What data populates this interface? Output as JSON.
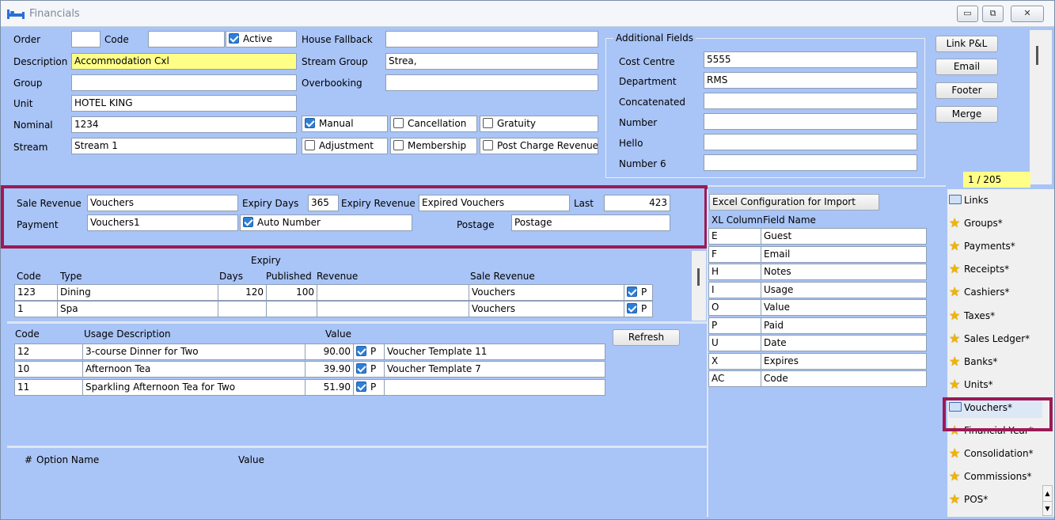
{
  "window": {
    "title": "Financials",
    "minimize": "▭",
    "restore": "⧉",
    "close": "✕"
  },
  "top": {
    "order_label": "Order",
    "order_value": "",
    "code_label": "Code",
    "code_value": "",
    "active_label": "Active",
    "description_label": "Description",
    "description_value": "Accommodation Cxl",
    "group_label": "Group",
    "group_value": "",
    "unit_label": "Unit",
    "unit_value": "HOTEL KING",
    "nominal_label": "Nominal",
    "nominal_value": "1234",
    "stream_label": "Stream",
    "stream_value": "Stream 1",
    "house_fallback_label": "House Fallback",
    "house_fallback_value": "",
    "stream_group_label": "Stream Group",
    "stream_group_value": "Strea,",
    "overbooking_label": "Overbooking",
    "overbooking_value": "",
    "manual_label": "Manual",
    "cancellation_label": "Cancellation",
    "gratuity_label": "Gratuity",
    "adjustment_label": "Adjustment",
    "membership_label": "Membership",
    "post_charge_label": "Post Charge Revenue"
  },
  "additional": {
    "title": "Additional Fields",
    "cost_centre_label": "Cost Centre",
    "cost_centre_value": "5555",
    "department_label": "Department",
    "department_value": "RMS",
    "concatenated_label": "Concatenated",
    "concatenated_value": "",
    "number_label": "Number",
    "number_value": "",
    "hello_label": "Hello",
    "hello_value": "",
    "number6_label": "Number 6",
    "number6_value": ""
  },
  "right_buttons": {
    "link_pl": "Link P&L",
    "email": "Email",
    "footer": "Footer",
    "merge": "Merge"
  },
  "record_counter": "1 / 205",
  "voucher_settings": {
    "sale_revenue_label": "Sale Revenue",
    "sale_revenue_value": "Vouchers",
    "expiry_days_label": "Expiry Days",
    "expiry_days_value": "365",
    "expiry_revenue_label": "Expiry Revenue",
    "expiry_revenue_value": "Expired Vouchers",
    "last_label": "Last",
    "last_value": "423",
    "payment_label": "Payment",
    "payment_value": "Vouchers1",
    "auto_number_label": "Auto Number",
    "postage_label": "Postage",
    "postage_value": "Postage"
  },
  "types_table": {
    "expiry_header": "Expiry",
    "headers": {
      "code": "Code",
      "type": "Type",
      "days": "Days",
      "published": "Published",
      "revenue": "Revenue",
      "sale_revenue": "Sale Revenue"
    },
    "rows": [
      {
        "code": "123",
        "type": "Dining",
        "days": "120",
        "published": "100",
        "revenue": "",
        "sale_revenue": "Vouchers",
        "p": "P"
      },
      {
        "code": "1",
        "type": "Spa",
        "days": "",
        "published": "",
        "revenue": "",
        "sale_revenue": "Vouchers",
        "p": "P"
      }
    ]
  },
  "usage_table": {
    "headers": {
      "code": "Code",
      "usage_description": "Usage Description",
      "value": "Value"
    },
    "refresh": "Refresh",
    "rows": [
      {
        "code": "12",
        "description": "3-course Dinner for Two",
        "value": "90.00",
        "p": "P",
        "template": "Voucher Template 11"
      },
      {
        "code": "10",
        "description": "Afternoon Tea",
        "value": "39.90",
        "p": "P",
        "template": "Voucher Template 7"
      },
      {
        "code": "11",
        "description": "Sparkling Afternoon Tea for Two",
        "value": "51.90",
        "p": "P",
        "template": ""
      }
    ]
  },
  "options_table": {
    "headers": {
      "num": "#",
      "option_name": "Option Name",
      "value": "Value"
    }
  },
  "excel": {
    "button": "Excel Configuration for Import",
    "headers": {
      "xl_column": "XL Column",
      "field_name": "Field Name"
    },
    "rows": [
      {
        "col": "E",
        "field": "Guest"
      },
      {
        "col": "F",
        "field": "Email"
      },
      {
        "col": "H",
        "field": "Notes"
      },
      {
        "col": "I",
        "field": "Usage"
      },
      {
        "col": "O",
        "field": "Value"
      },
      {
        "col": "P",
        "field": "Paid"
      },
      {
        "col": "U",
        "field": "Date"
      },
      {
        "col": "X",
        "field": "Expires"
      },
      {
        "col": "AC",
        "field": "Code"
      }
    ]
  },
  "sidebar": {
    "items": [
      {
        "label": "Links",
        "icon": "links-icon"
      },
      {
        "label": "Groups*",
        "icon": "star-icon"
      },
      {
        "label": "Payments*",
        "icon": "star-icon"
      },
      {
        "label": "Receipts*",
        "icon": "star-icon"
      },
      {
        "label": "Cashiers*",
        "icon": "star-icon"
      },
      {
        "label": "Taxes*",
        "icon": "star-icon"
      },
      {
        "label": "Sales Ledger*",
        "icon": "star-icon"
      },
      {
        "label": "Banks*",
        "icon": "star-icon"
      },
      {
        "label": "Units*",
        "icon": "star-icon"
      },
      {
        "label": "Vouchers*",
        "icon": "vouchers-icon"
      },
      {
        "label": "Financial Year*",
        "icon": "star-icon"
      },
      {
        "label": "Consolidation*",
        "icon": "star-icon"
      },
      {
        "label": "Commissions*",
        "icon": "star-icon"
      },
      {
        "label": "POS*",
        "icon": "star-icon"
      }
    ]
  },
  "colors": {
    "panel": "#a9c4f6",
    "highlight_border": "#9c1a55",
    "yellow_row": "#ffff88",
    "peach_cell": "#fcd5c0",
    "check_blue": "#2f7fd8"
  }
}
